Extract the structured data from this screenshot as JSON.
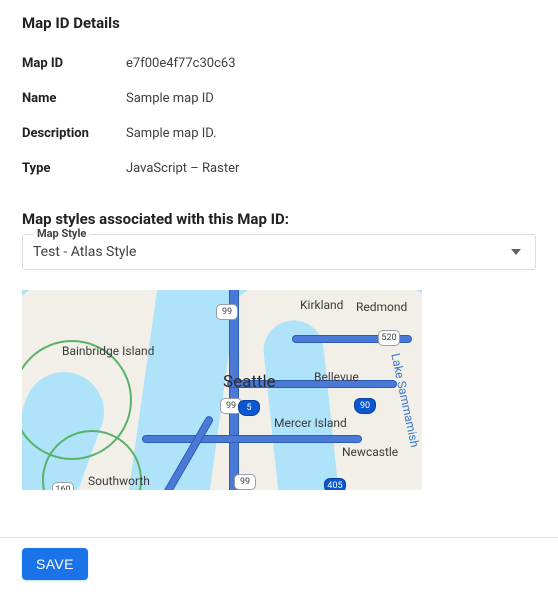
{
  "section_title": "Map ID Details",
  "details": {
    "map_id": {
      "label": "Map ID",
      "value": "e7f00e4f77c30c63"
    },
    "name": {
      "label": "Name",
      "value": "Sample map ID"
    },
    "description": {
      "label": "Description",
      "value": "Sample map ID."
    },
    "type": {
      "label": "Type",
      "value": "JavaScript – Raster"
    }
  },
  "assoc_title": "Map styles associated with this Map ID:",
  "map_style": {
    "label": "Map Style",
    "selected": "Test - Atlas Style"
  },
  "map_labels": {
    "seattle": "Seattle",
    "bellevue": "Bellevue",
    "kirkland": "Kirkland",
    "redmond": "Redmond",
    "mercer": "Mercer Island",
    "newcastle": "Newcastle",
    "bainbridge": "Bainbridge Island",
    "southworth": "Southworth",
    "sammamish": "Lake Sammamish"
  },
  "shields": {
    "s99a": "99",
    "s99b": "99",
    "s99c": "99",
    "i5": "5",
    "i90": "90",
    "i405": "405",
    "s520": "520",
    "s160": "160"
  },
  "footer": {
    "save_label": "SAVE"
  }
}
